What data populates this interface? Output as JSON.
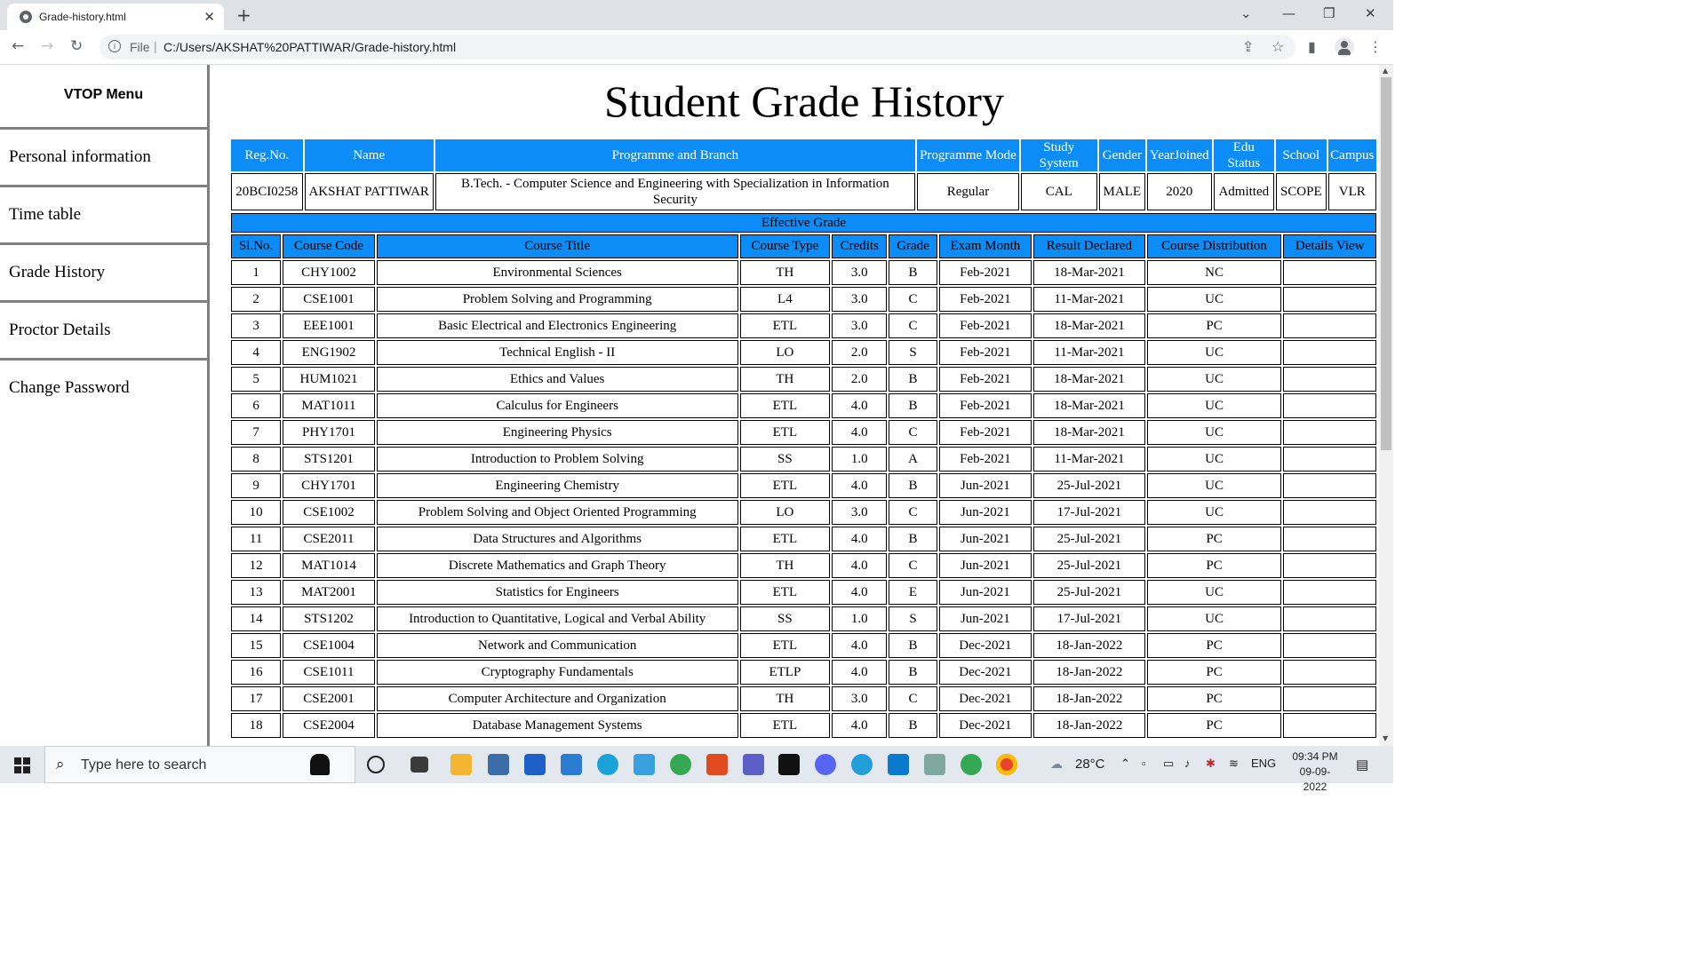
{
  "browser": {
    "tab_title": "Grade-history.html",
    "tab_close": "✕",
    "new_tab": "+",
    "scheme": "File",
    "url": "C:/Users/AKSHAT%20PATTIWAR/Grade-history.html"
  },
  "sidebar": {
    "title": "VTOP Menu",
    "items": [
      {
        "label": "Personal information"
      },
      {
        "label": "Time table"
      },
      {
        "label": "Grade History"
      },
      {
        "label": "Proctor Details"
      },
      {
        "label": "Change Password"
      }
    ]
  },
  "page": {
    "title": "Student Grade History"
  },
  "student_info": {
    "headers": [
      "Reg.No.",
      "Name",
      "Programme and Branch",
      "Programme Mode",
      "Study System",
      "Gender",
      "YearJoined",
      "Edu Status",
      "School",
      "Campus"
    ],
    "values": [
      "20BCI0258",
      "AKSHAT PATTIWAR",
      "B.Tech. - Computer Science and Engineering with Specialization in Information Security",
      "Regular",
      "CAL",
      "MALE",
      "2020",
      "Admitted",
      "SCOPE",
      "VLR"
    ]
  },
  "grades": {
    "caption": "Effective Grade",
    "headers": [
      "Sl.No.",
      "Course Code",
      "Course Title",
      "Course Type",
      "Credits",
      "Grade",
      "Exam Month",
      "Result Declared",
      "Course Distribution",
      "Details View"
    ],
    "rows": [
      [
        "1",
        "CHY1002",
        "Environmental Sciences",
        "TH",
        "3.0",
        "B",
        "Feb-2021",
        "18-Mar-2021",
        "NC",
        ""
      ],
      [
        "2",
        "CSE1001",
        "Problem Solving and Programming",
        "L4",
        "3.0",
        "C",
        "Feb-2021",
        "11-Mar-2021",
        "UC",
        ""
      ],
      [
        "3",
        "EEE1001",
        "Basic Electrical and Electronics Engineering",
        "ETL",
        "3.0",
        "C",
        "Feb-2021",
        "18-Mar-2021",
        "PC",
        ""
      ],
      [
        "4",
        "ENG1902",
        "Technical English - II",
        "LO",
        "2.0",
        "S",
        "Feb-2021",
        "11-Mar-2021",
        "UC",
        ""
      ],
      [
        "5",
        "HUM1021",
        "Ethics and Values",
        "TH",
        "2.0",
        "B",
        "Feb-2021",
        "18-Mar-2021",
        "UC",
        ""
      ],
      [
        "6",
        "MAT1011",
        "Calculus for Engineers",
        "ETL",
        "4.0",
        "B",
        "Feb-2021",
        "18-Mar-2021",
        "UC",
        ""
      ],
      [
        "7",
        "PHY1701",
        "Engineering Physics",
        "ETL",
        "4.0",
        "C",
        "Feb-2021",
        "18-Mar-2021",
        "UC",
        ""
      ],
      [
        "8",
        "STS1201",
        "Introduction to Problem Solving",
        "SS",
        "1.0",
        "A",
        "Feb-2021",
        "11-Mar-2021",
        "UC",
        ""
      ],
      [
        "9",
        "CHY1701",
        "Engineering Chemistry",
        "ETL",
        "4.0",
        "B",
        "Jun-2021",
        "25-Jul-2021",
        "UC",
        ""
      ],
      [
        "10",
        "CSE1002",
        "Problem Solving and Object Oriented Programming",
        "LO",
        "3.0",
        "C",
        "Jun-2021",
        "17-Jul-2021",
        "UC",
        ""
      ],
      [
        "11",
        "CSE2011",
        "Data Structures and Algorithms",
        "ETL",
        "4.0",
        "B",
        "Jun-2021",
        "25-Jul-2021",
        "PC",
        ""
      ],
      [
        "12",
        "MAT1014",
        "Discrete Mathematics and Graph Theory",
        "TH",
        "4.0",
        "C",
        "Jun-2021",
        "25-Jul-2021",
        "PC",
        ""
      ],
      [
        "13",
        "MAT2001",
        "Statistics for Engineers",
        "ETL",
        "4.0",
        "E",
        "Jun-2021",
        "25-Jul-2021",
        "UC",
        ""
      ],
      [
        "14",
        "STS1202",
        "Introduction to Quantitative, Logical and Verbal Ability",
        "SS",
        "1.0",
        "S",
        "Jun-2021",
        "17-Jul-2021",
        "UC",
        ""
      ],
      [
        "15",
        "CSE1004",
        "Network and Communication",
        "ETL",
        "4.0",
        "B",
        "Dec-2021",
        "18-Jan-2022",
        "PC",
        ""
      ],
      [
        "16",
        "CSE1011",
        "Cryptography Fundamentals",
        "ETLP",
        "4.0",
        "B",
        "Dec-2021",
        "18-Jan-2022",
        "PC",
        ""
      ],
      [
        "17",
        "CSE2001",
        "Computer Architecture and Organization",
        "TH",
        "3.0",
        "C",
        "Dec-2021",
        "18-Jan-2022",
        "PC",
        ""
      ],
      [
        "18",
        "CSE2004",
        "Database Management Systems",
        "ETL",
        "4.0",
        "B",
        "Dec-2021",
        "18-Jan-2022",
        "PC",
        ""
      ]
    ]
  },
  "taskbar": {
    "search_placeholder": "Type here to search",
    "weather": "28°C",
    "language": "ENG",
    "time": "09:34 PM",
    "date": "09-09-2022"
  },
  "colors": {
    "header_blue": "#0b8cf7"
  }
}
